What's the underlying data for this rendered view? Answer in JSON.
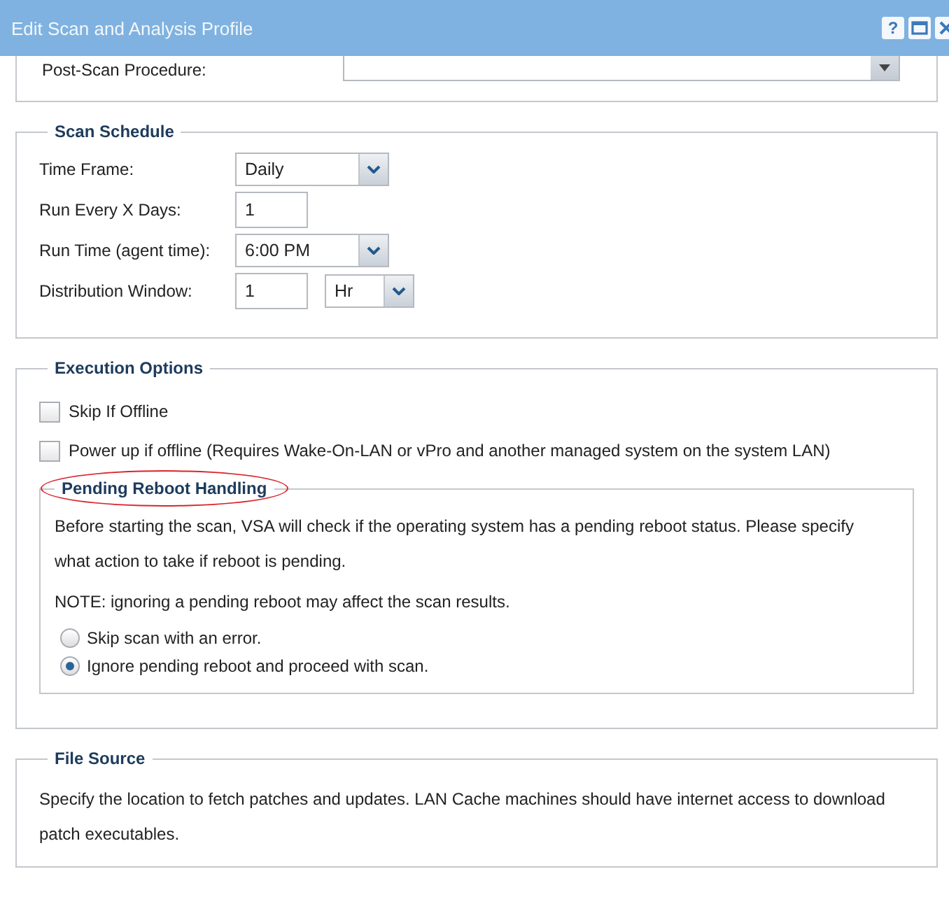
{
  "window": {
    "title": "Edit Scan and Analysis Profile",
    "help_button": "?"
  },
  "post_scan": {
    "label": "Post-Scan Procedure:"
  },
  "scan_schedule": {
    "legend": "Scan Schedule",
    "fields": [
      {
        "kind": "select",
        "label": "Time Frame:",
        "value": "Daily"
      },
      {
        "kind": "text",
        "label": "Run Every X Days:",
        "value": "1"
      },
      {
        "kind": "select",
        "label": "Run Time (agent time):",
        "value": "6:00 PM"
      },
      {
        "kind": "text_select",
        "label": "Distribution Window:",
        "value": "1",
        "unit": "Hr"
      }
    ]
  },
  "execution_options": {
    "legend": "Execution Options",
    "checkboxes": [
      {
        "label": "Skip If Offline",
        "checked": false
      },
      {
        "label": "Power up if offline (Requires Wake-On-LAN or vPro and another managed system on the system LAN)",
        "checked": false
      }
    ],
    "pending_reboot": {
      "legend": "Pending Reboot Handling",
      "highlighted": true,
      "paragraphs": [
        "Before starting the scan, VSA will check if the operating system has a pending reboot status. Please specify what action to take if reboot is pending.",
        "NOTE: ignoring a pending reboot may affect the scan results."
      ],
      "options": [
        {
          "label": "Skip scan with an error.",
          "selected": false
        },
        {
          "label": "Ignore pending reboot and proceed with scan.",
          "selected": true
        }
      ]
    }
  },
  "file_source": {
    "legend": "File Source",
    "text": "Specify the location to fetch patches and updates. LAN Cache machines should have internet access to download patch executables."
  }
}
